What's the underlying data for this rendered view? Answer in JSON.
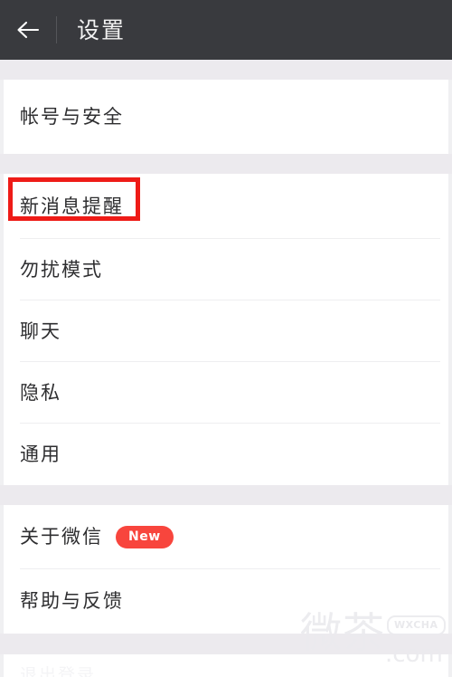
{
  "header": {
    "title": "设置",
    "back_icon": "arrow-left-icon",
    "bg_color": "#393a3e",
    "text_color": "#f2f2f2"
  },
  "groups": [
    {
      "id": "account-group",
      "items": [
        {
          "label": "帐号与安全",
          "badge": null
        }
      ]
    },
    {
      "id": "notifications-group",
      "items": [
        {
          "label": "新消息提醒",
          "badge": null
        },
        {
          "label": "勿扰模式",
          "badge": null
        },
        {
          "label": "聊天",
          "badge": null
        },
        {
          "label": "隐私",
          "badge": null
        },
        {
          "label": "通用",
          "badge": null
        }
      ]
    },
    {
      "id": "about-group",
      "items": [
        {
          "label": "关于微信",
          "badge": "New"
        },
        {
          "label": "帮助与反馈",
          "badge": null
        }
      ]
    }
  ],
  "annotation": {
    "target_label": "新消息提醒",
    "color": "#ee1b17"
  },
  "badge": {
    "new_label": "New",
    "color": "#f8453d"
  },
  "bottom_cut_row": {
    "label": "退出登录"
  },
  "watermark": {
    "cn": "微茶",
    "bubble": "WXCHA",
    "domain": ".com"
  }
}
